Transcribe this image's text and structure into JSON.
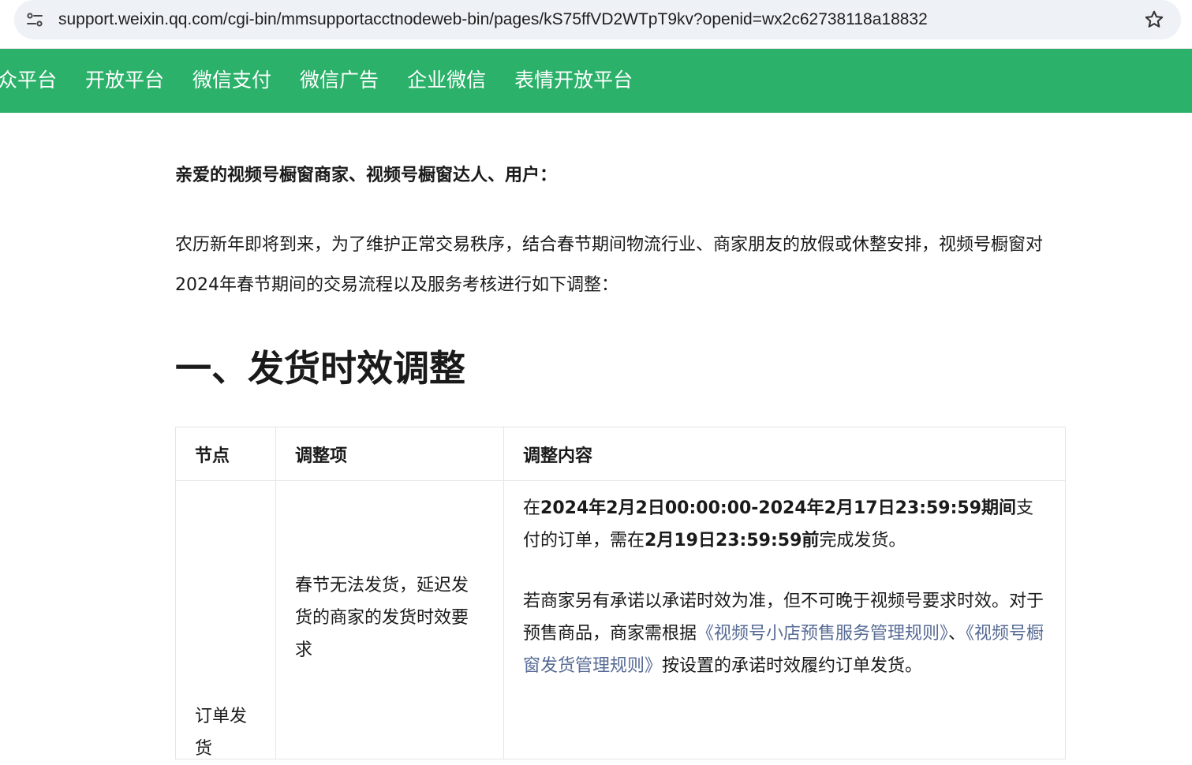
{
  "browser": {
    "url": "support.weixin.qq.com/cgi-bin/mmsupportacctnodeweb-bin/pages/kS75ffVD2WTpT9kv?openid=wx2c62738118a18832"
  },
  "colors": {
    "nav_green": "#2bb16a",
    "link_blue": "#576b95"
  },
  "nav": {
    "items": [
      "公众平台",
      "开放平台",
      "微信支付",
      "微信广告",
      "企业微信",
      "表情开放平台"
    ]
  },
  "article": {
    "greeting": "亲爱的视频号橱窗商家、视频号橱窗达人、用户：",
    "intro": "农历新年即将到来，为了维护正常交易秩序，结合春节期间物流行业、商家朋友的放假或休整安排，视频号橱窗对2024年春节期间的交易流程以及服务考核进行如下调整：",
    "section_1_heading": "一、发货时效调整",
    "table": {
      "headers": [
        "节点",
        "调整项",
        "调整内容"
      ],
      "row1": {
        "node": "订单发货",
        "item": "春节无法发货，延迟发货的商家的发货时效要求",
        "p1_a": "在",
        "p1_b": "2024年2月2日00:00:00-2024年2月17日23:59:59期间",
        "p1_c": "支付的订单，需在",
        "p1_d": "2月19日23:59:59前",
        "p1_e": "完成发货。",
        "p2_a": "若商家另有承诺以承诺时效为准，但不可晚于视频号要求时效。对于预售商品，商家需根据",
        "p2_link1": "《视频号小店预售服务管理规则》",
        "p2_sep": "、",
        "p2_link2": "《视频号橱窗发货管理规则》",
        "p2_b": "按设置的承诺时效履约订单发货。"
      }
    }
  }
}
